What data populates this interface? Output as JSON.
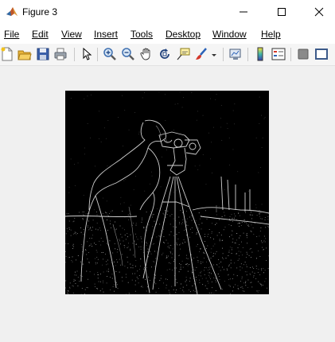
{
  "window": {
    "title": "Figure 3"
  },
  "menu": [
    {
      "key": "file",
      "label": "File"
    },
    {
      "key": "edit",
      "label": "Edit"
    },
    {
      "key": "view",
      "label": "View"
    },
    {
      "key": "insert",
      "label": "Insert"
    },
    {
      "key": "tools",
      "label": "Tools"
    },
    {
      "key": "desktop",
      "label": "Desktop"
    },
    {
      "key": "window",
      "label": "Window"
    },
    {
      "key": "help",
      "label": "Help"
    }
  ],
  "toolbar_icons": [
    "new-figure-icon",
    "open-file-icon",
    "save-figure-icon",
    "print-figure-icon",
    "edit-plot-arrow-icon",
    "zoom-in-icon",
    "zoom-out-icon",
    "pan-hand-icon",
    "rotate-3d-icon",
    "data-cursor-icon",
    "brush-icon",
    "brush-dropdown-icon",
    "link-plot-icon",
    "insert-colorbar-icon",
    "insert-legend-icon",
    "hide-plot-tools-icon",
    "show-plot-tools-icon"
  ],
  "figure": {
    "background": "#f0f0f0",
    "image_background": "#000000",
    "image_description": "cameraman-edge-detection"
  },
  "colors": {
    "titlebar": "#ffffff",
    "toolbar": "#f5f5f5"
  }
}
